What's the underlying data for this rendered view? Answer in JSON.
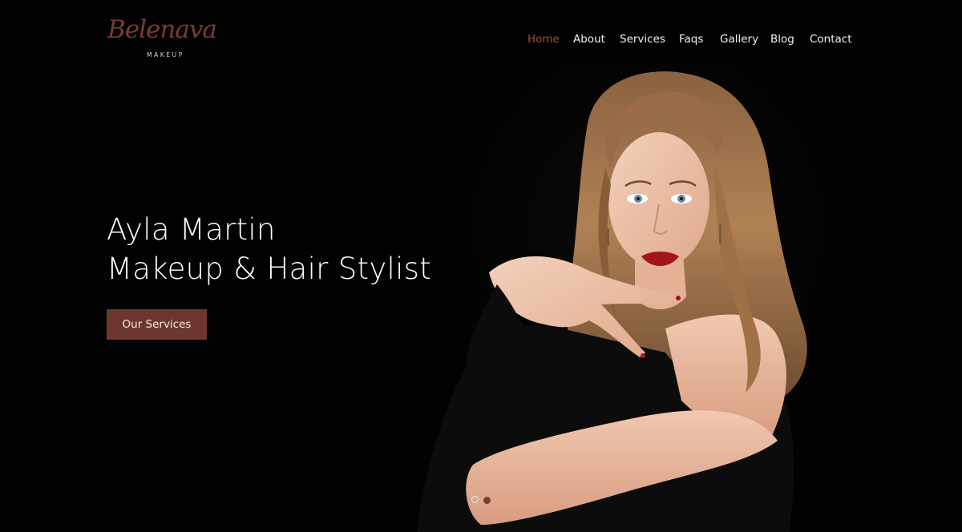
{
  "logo": {
    "script": "Belenava",
    "sub": "MAKEUP"
  },
  "nav": {
    "items": [
      {
        "label": "Home",
        "active": true
      },
      {
        "label": "About",
        "active": false
      },
      {
        "label": "Services",
        "active": false
      },
      {
        "label": "Faqs",
        "active": false
      },
      {
        "label": "Gallery",
        "active": false
      },
      {
        "label": "Blog",
        "active": false
      },
      {
        "label": "Contact",
        "active": false
      }
    ]
  },
  "hero": {
    "name": "Ayla  Martin",
    "role": "Makeup &  Hair Stylist",
    "cta_label": "Our Services"
  },
  "carousel": {
    "slide_count": 2,
    "active_slide": 2
  },
  "colors": {
    "accent": "#7a3b33",
    "button": "#6d3730",
    "background": "#020202",
    "text": "#ffffff"
  }
}
